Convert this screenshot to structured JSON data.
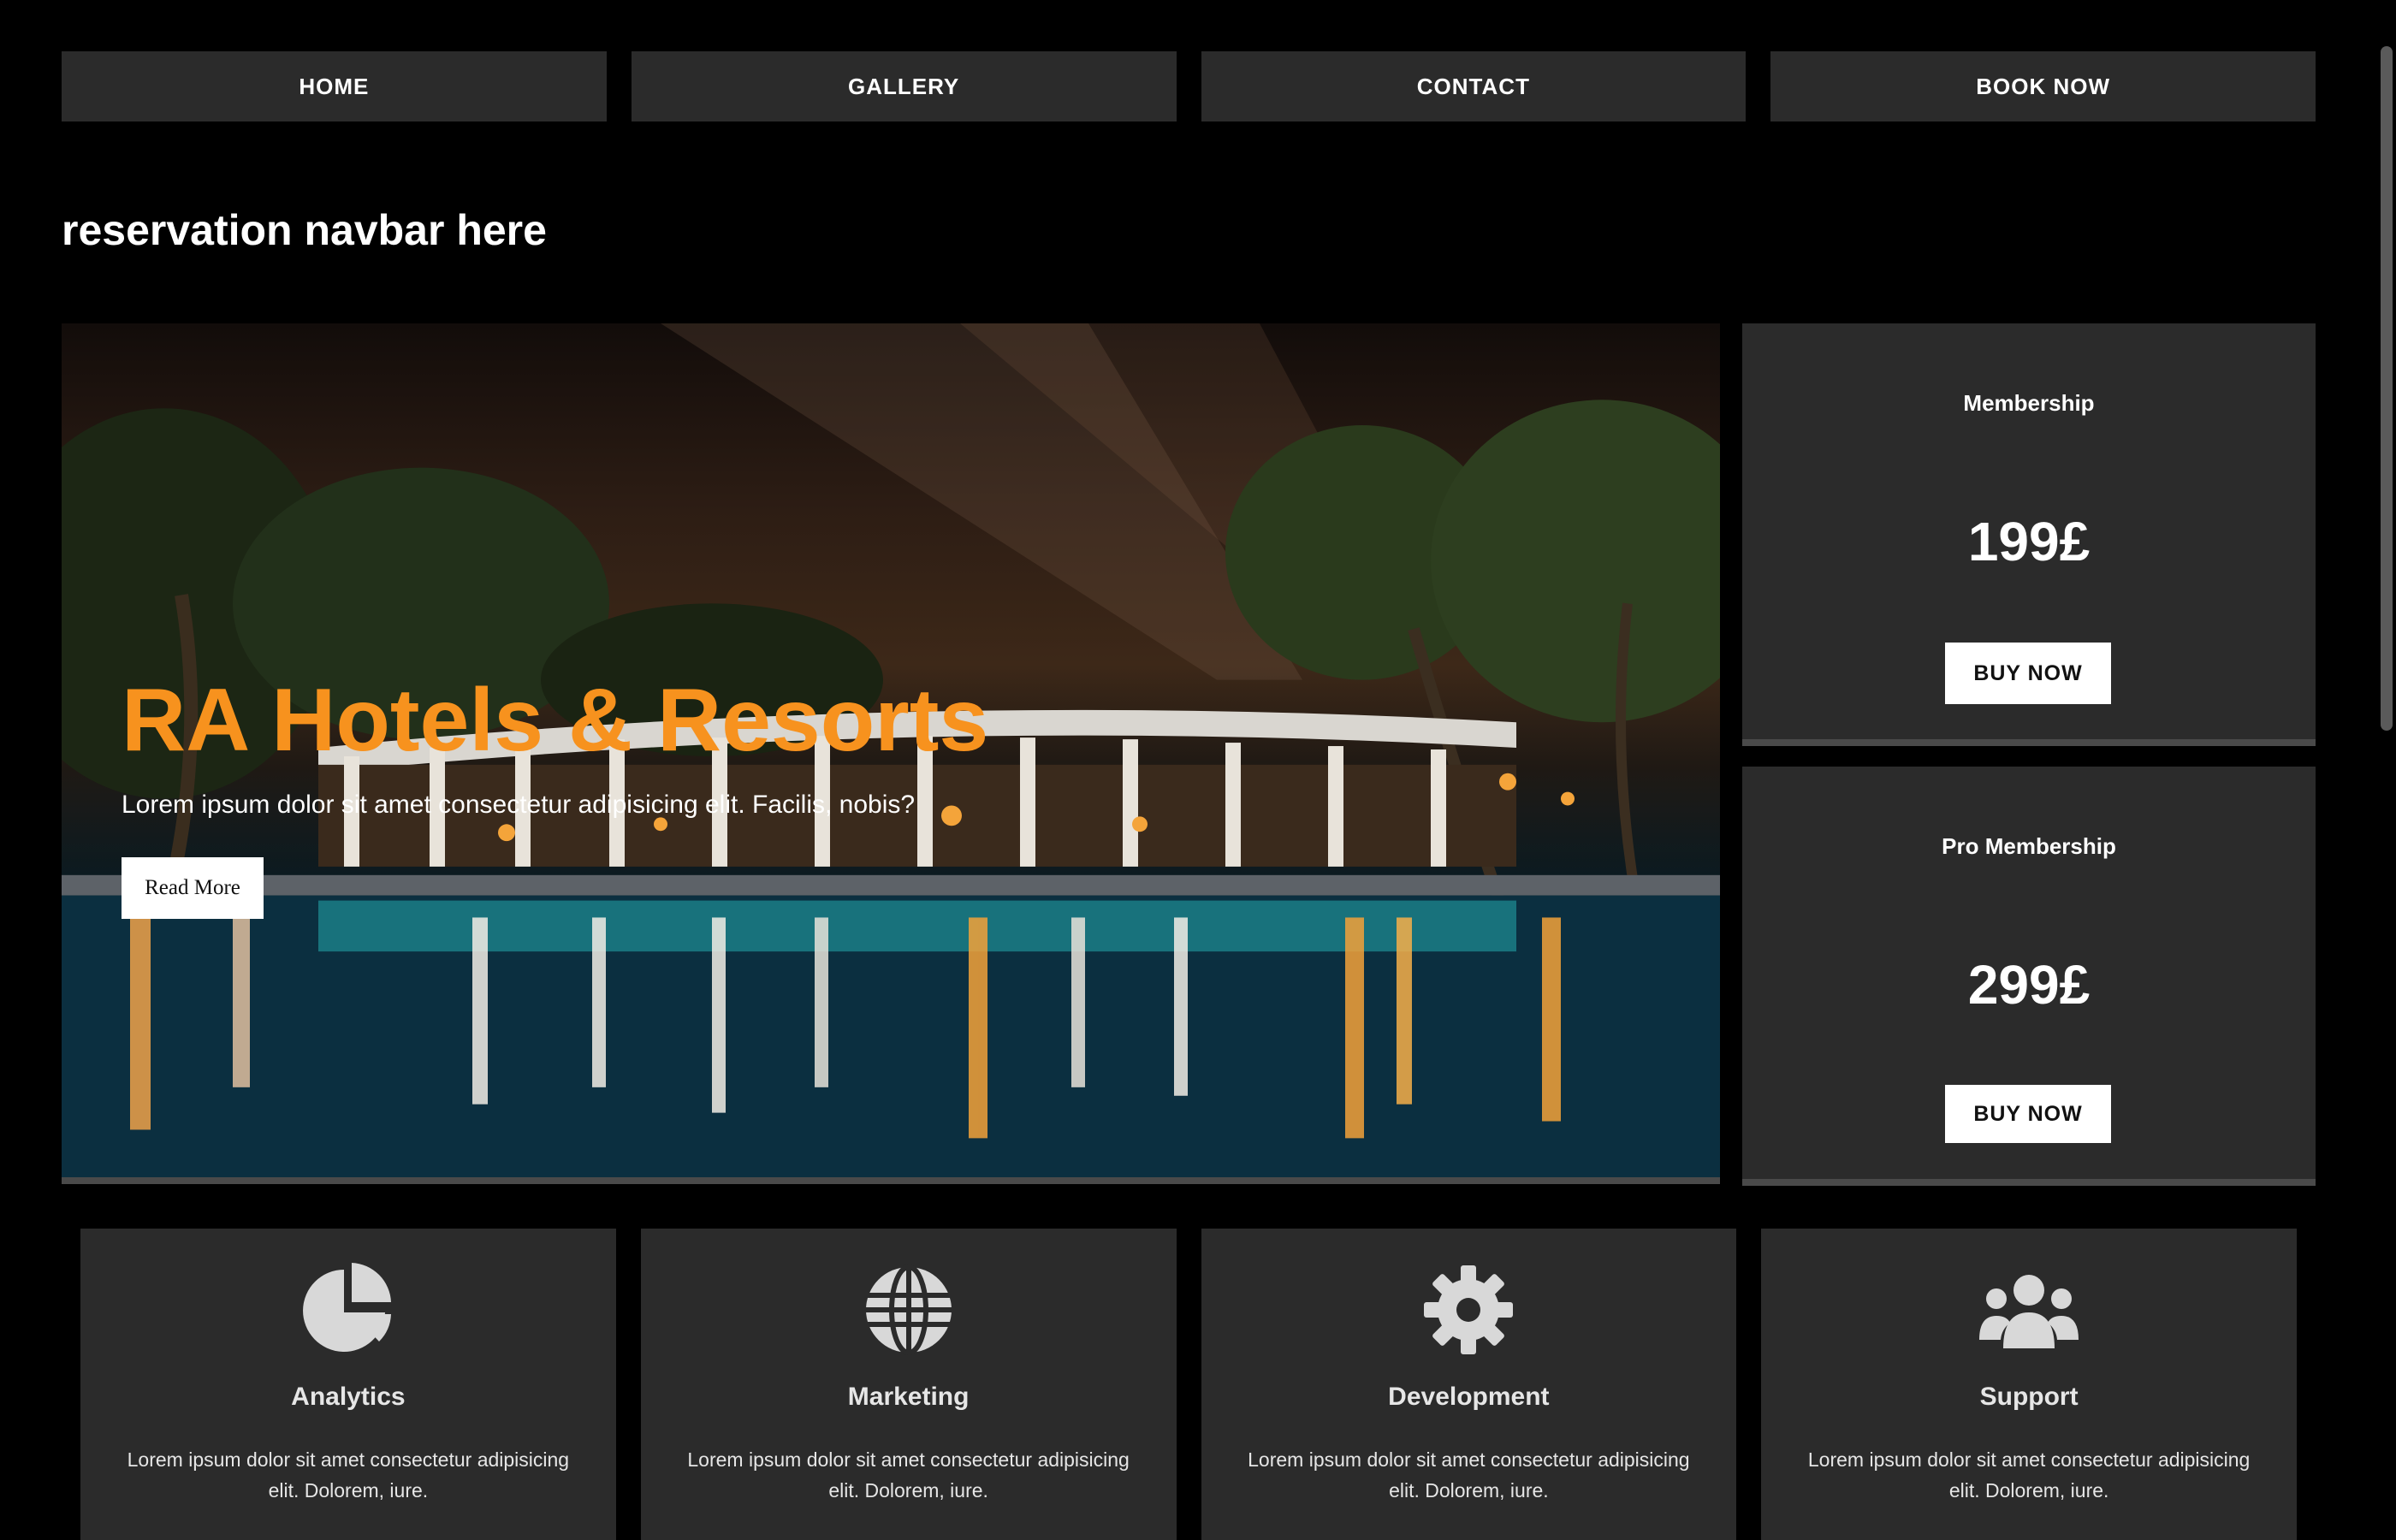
{
  "nav": {
    "items": [
      {
        "label": "HOME"
      },
      {
        "label": "GALLERY"
      },
      {
        "label": "CONTACT"
      },
      {
        "label": "BOOK NOW"
      }
    ]
  },
  "page": {
    "heading": "reservation navbar here"
  },
  "hero": {
    "title": "RA Hotels & Resorts",
    "text": "Lorem ipsum dolor sit amet consectetur adipisicing elit. Facilis, nobis?",
    "button_label": "Read More",
    "title_color": "#f7921e"
  },
  "memberships": [
    {
      "title": "Membership",
      "price": "199£",
      "button_label": "BUY NOW"
    },
    {
      "title": "Pro Membership",
      "price": "299£",
      "button_label": "BUY NOW"
    }
  ],
  "features": [
    {
      "icon": "pie-chart-icon",
      "title": "Analytics",
      "text": "Lorem ipsum dolor sit amet consectetur adipisicing elit. Dolorem, iure."
    },
    {
      "icon": "globe-icon",
      "title": "Marketing",
      "text": "Lorem ipsum dolor sit amet consectetur adipisicing elit. Dolorem, iure."
    },
    {
      "icon": "gear-icon",
      "title": "Development",
      "text": "Lorem ipsum dolor sit amet consectetur adipisicing elit. Dolorem, iure."
    },
    {
      "icon": "users-icon",
      "title": "Support",
      "text": "Lorem ipsum dolor sit amet consectetur adipisicing elit. Dolorem, iure."
    }
  ],
  "colors": {
    "background": "#000000",
    "panel": "#2b2b2b",
    "accent": "#f7921e"
  }
}
